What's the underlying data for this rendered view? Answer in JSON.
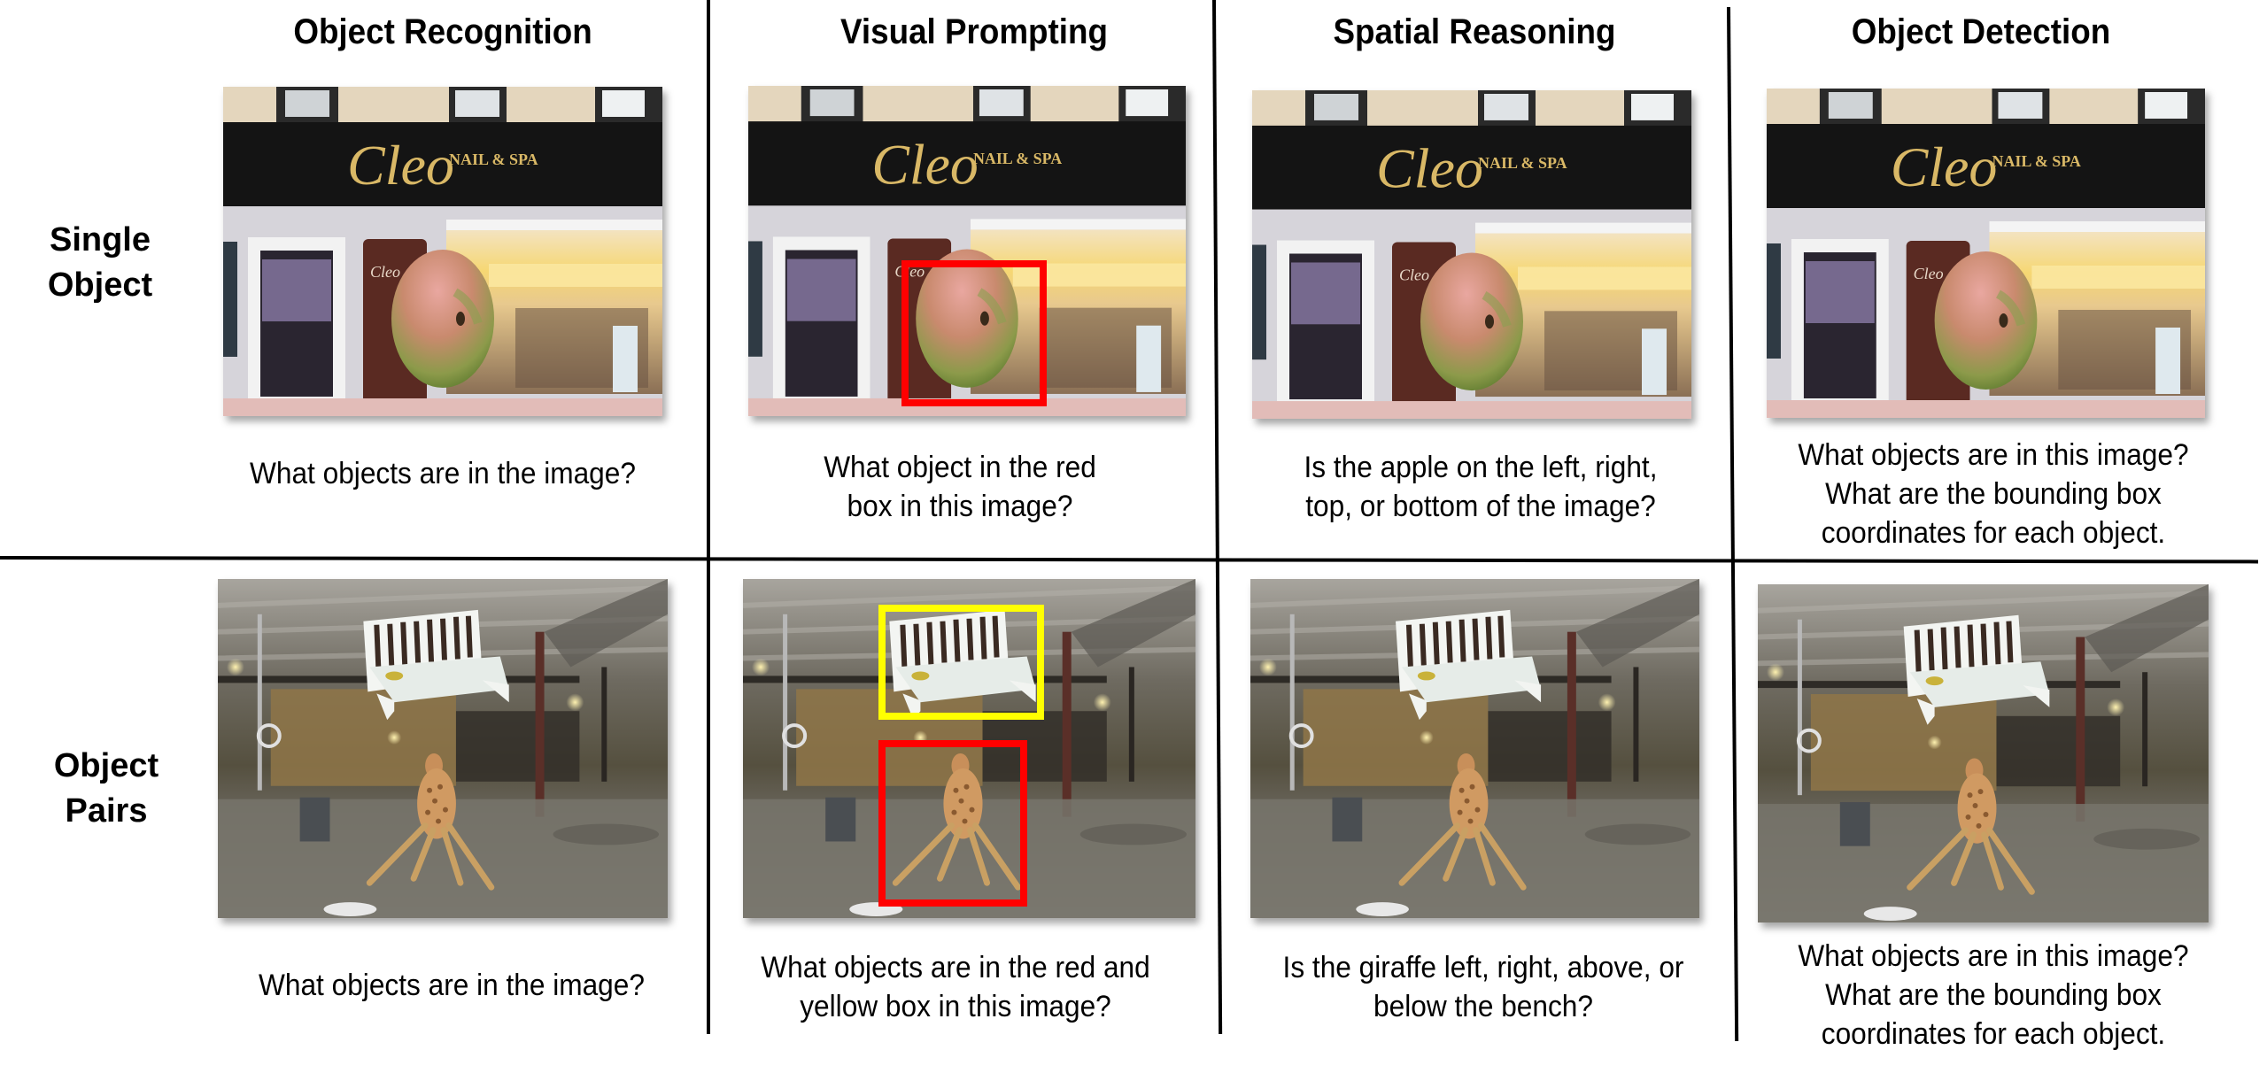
{
  "columns": [
    {
      "id": "object-recognition",
      "title": "Object Recognition"
    },
    {
      "id": "visual-prompting",
      "title": "Visual Prompting"
    },
    {
      "id": "spatial-reasoning",
      "title": "Spatial Reasoning"
    },
    {
      "id": "object-detection",
      "title": "Object Detection"
    }
  ],
  "rows": [
    {
      "id": "single-object",
      "label_lines": [
        "Single",
        "Object"
      ],
      "scene": "storefront-with-apple",
      "scene_text": {
        "sign_script": "Cleo",
        "sign_caption": "NAIL & SPA"
      },
      "cells": [
        {
          "caption_lines": [
            "What objects are in the image?"
          ],
          "boxes": []
        },
        {
          "caption_lines": [
            "What object in the red",
            "box in this image?"
          ],
          "boxes": [
            {
              "target": "apple",
              "color": "#ff0000"
            }
          ]
        },
        {
          "caption_lines": [
            "Is the apple on the left, right,",
            "top, or bottom of the image?"
          ],
          "boxes": []
        },
        {
          "caption_lines": [
            "What objects are in this image?",
            "What are the bounding box",
            "coordinates for each object."
          ],
          "boxes": []
        }
      ]
    },
    {
      "id": "object-pairs",
      "label_lines": [
        "Object",
        "Pairs"
      ],
      "scene": "warehouse-with-bench-and-giraffe",
      "cells": [
        {
          "caption_lines": [
            "What objects are in the image?"
          ],
          "boxes": []
        },
        {
          "caption_lines": [
            "What objects are in the red and",
            "yellow box in this image?"
          ],
          "boxes": [
            {
              "target": "bench",
              "color": "#ffff00"
            },
            {
              "target": "giraffe",
              "color": "#ff0000"
            }
          ]
        },
        {
          "caption_lines": [
            "Is the giraffe left, right, above, or",
            "below the bench?"
          ],
          "boxes": []
        },
        {
          "caption_lines": [
            "What objects are in this image?",
            "What are the bounding box",
            "coordinates for each object."
          ],
          "boxes": []
        }
      ]
    }
  ],
  "colors": {
    "red_box": "#ff0000",
    "yellow_box": "#ffff00",
    "divider": "#000000"
  }
}
